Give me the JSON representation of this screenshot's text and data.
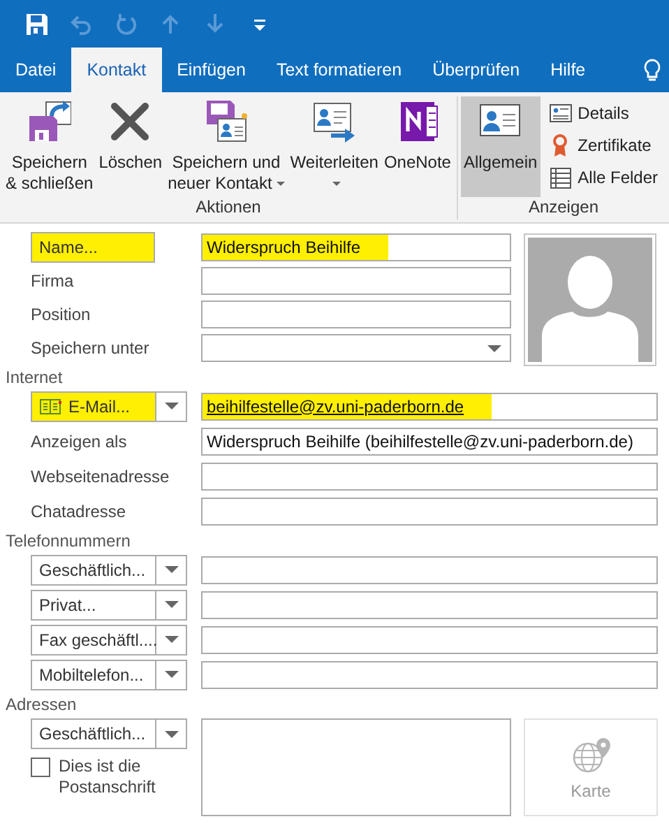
{
  "quick_access": [
    {
      "kind": "save",
      "disabled": false
    },
    {
      "kind": "undo",
      "disabled": true
    },
    {
      "kind": "redo",
      "disabled": true
    },
    {
      "kind": "up",
      "disabled": true
    },
    {
      "kind": "down",
      "disabled": true
    },
    {
      "kind": "customize",
      "disabled": false
    }
  ],
  "tabs": [
    {
      "label": "Datei",
      "selected": false
    },
    {
      "label": "Kontakt",
      "selected": true
    },
    {
      "label": "Einfügen",
      "selected": false
    },
    {
      "label": "Text formatieren",
      "selected": false
    },
    {
      "label": "Überprüfen",
      "selected": false
    },
    {
      "label": "Hilfe",
      "selected": false
    }
  ],
  "ribbon": {
    "actions": {
      "label": "Aktionen",
      "buttons": [
        {
          "kind": "save-close",
          "label": "Speichern\n& schließen",
          "dropdown": false
        },
        {
          "kind": "delete",
          "label": "Löschen",
          "dropdown": false
        },
        {
          "kind": "save-new",
          "label": "Speichern und\nneuer Kontakt",
          "dropdown": true
        },
        {
          "kind": "forward",
          "label": "Weiterleiten",
          "dropdown": true
        },
        {
          "kind": "onenote",
          "label": "OneNote",
          "dropdown": false
        }
      ]
    },
    "views": {
      "label": "Anzeigen",
      "buttons": [
        {
          "kind": "general",
          "label": "Allgemein",
          "selected": true
        },
        {
          "kind": "details",
          "label": "Details",
          "selected": false
        },
        {
          "kind": "certificates",
          "label": "Zertifikate",
          "selected": false
        },
        {
          "kind": "all-fields",
          "label": "Alle Felder",
          "selected": false
        }
      ]
    }
  },
  "contact_fields": [
    {
      "kind": "button",
      "label": "Name...",
      "value": "Widerspruch Beihilfe",
      "highlighted": true
    },
    {
      "kind": "label",
      "label": "Firma"
    },
    {
      "kind": "label",
      "label": "Position"
    },
    {
      "kind": "combo",
      "label": "Speichern unter"
    }
  ],
  "internet": {
    "heading": "Internet",
    "fields": [
      {
        "kind": "split",
        "label": "E-Mail...",
        "value": "beihilfestelle@zv.uni-paderborn.de",
        "link": true,
        "highlighted": true
      },
      {
        "kind": "label",
        "label": "Anzeigen als",
        "value": "Widerspruch Beihilfe (beihilfestelle@zv.uni-paderborn.de)"
      },
      {
        "kind": "label",
        "label": "Webseitenadresse"
      },
      {
        "kind": "label",
        "label": "Chatadresse"
      }
    ]
  },
  "phones": {
    "heading": "Telefonnummern",
    "fields": [
      {
        "kind": "split",
        "label": "Geschäftlich..."
      },
      {
        "kind": "split",
        "label": "Privat..."
      },
      {
        "kind": "split",
        "label": "Fax geschäftl...."
      },
      {
        "kind": "split",
        "label": "Mobiltelefon..."
      }
    ]
  },
  "addresses": {
    "heading": "Adressen",
    "type": "Geschäftlich...",
    "postal_checkbox": {
      "label": "Dies ist die Postanschrift",
      "checked": false
    },
    "map_button": {
      "label": "Karte",
      "disabled": true
    }
  }
}
